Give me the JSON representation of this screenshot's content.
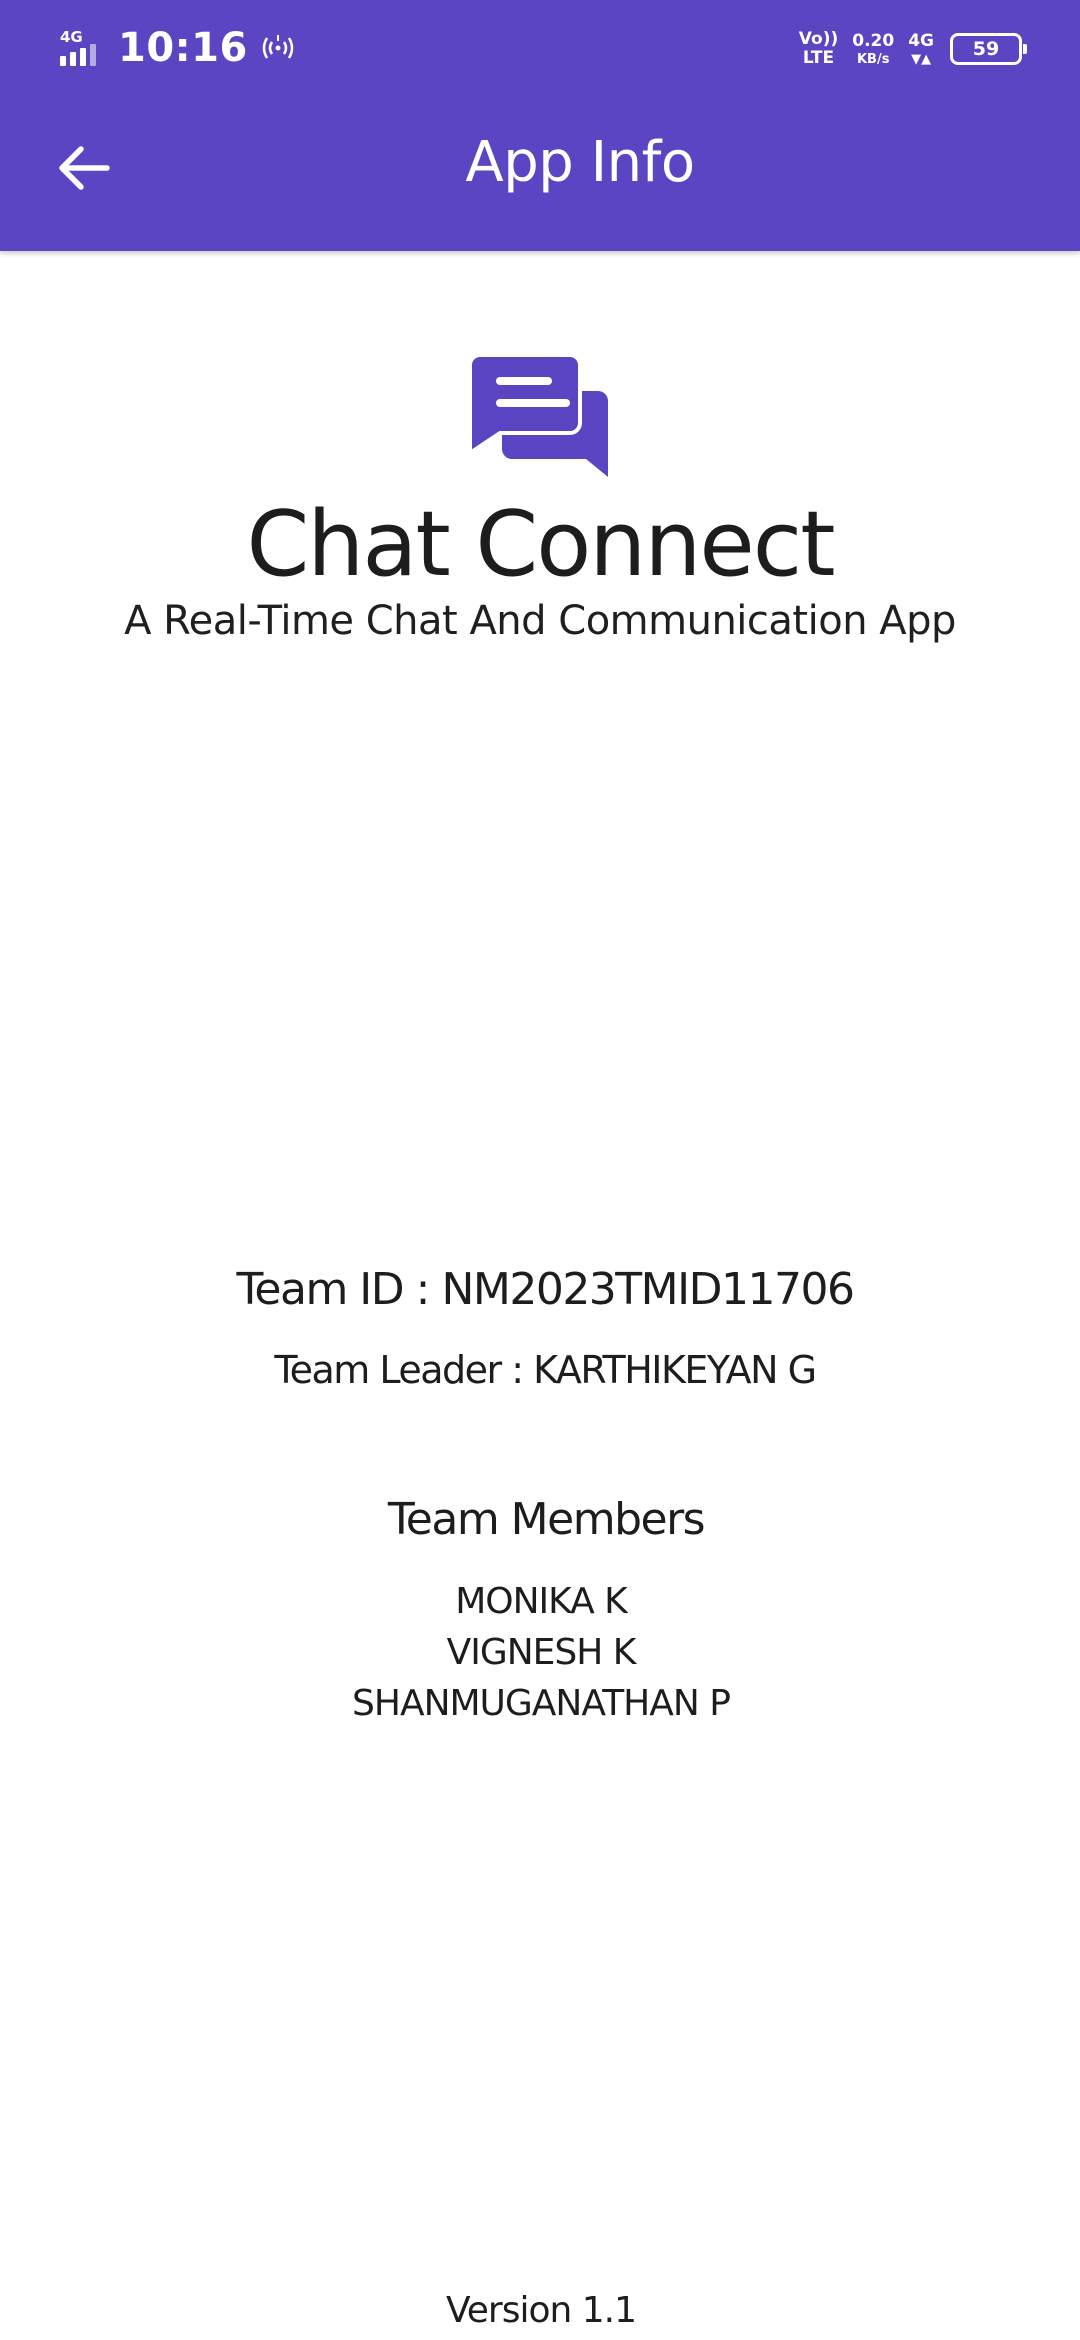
{
  "status_bar": {
    "signal_tag": "4G",
    "time": "10:16",
    "volte_top": "Vo))",
    "volte_bottom": "LTE",
    "speed_value": "0.20",
    "speed_unit": "KB/s",
    "network_tag": "4G",
    "battery_level": "59",
    "icons": [
      "signal-icon",
      "hotspot-icon",
      "data-arrows-icon",
      "battery-icon"
    ]
  },
  "app_bar": {
    "title": "App Info",
    "back_icon": "arrow-left-icon"
  },
  "app": {
    "logo_icon": "chat-bubbles-icon",
    "name": "Chat Connect",
    "tagline": "A Real-Time Chat And Communication App"
  },
  "team": {
    "id_line": "Team ID : NM2023TMID11706",
    "leader_line": "Team Leader : KARTHIKEYAN G",
    "members_heading": "Team Members",
    "members": [
      "MONIKA K",
      "VIGNESH K",
      "SHANMUGANATHAN P"
    ]
  },
  "footer": {
    "version": "Version 1.1"
  },
  "colors": {
    "primary": "#5c45c3",
    "text": "#1d1d1d",
    "background": "#ffffff"
  }
}
